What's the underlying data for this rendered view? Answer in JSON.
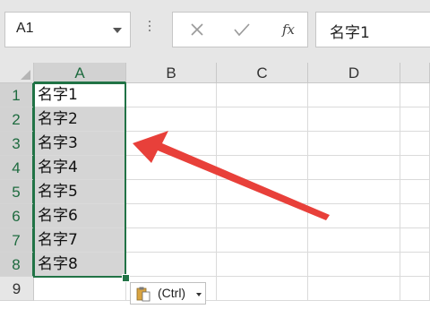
{
  "name_box": {
    "value": "A1",
    "dropdown_icon": "chevron-down-icon"
  },
  "formula_bar": {
    "cancel_icon": "close-icon",
    "enter_icon": "check-icon",
    "fx_label": "fx",
    "value": "名字1"
  },
  "columns": [
    "A",
    "B",
    "C",
    "D"
  ],
  "rows": [
    "1",
    "2",
    "3",
    "4",
    "5",
    "6",
    "7",
    "8",
    "9"
  ],
  "cells": {
    "A": [
      "名字1",
      "名字2",
      "名字3",
      "名字4",
      "名字5",
      "名字6",
      "名字7",
      "名字8",
      ""
    ]
  },
  "selected_range": "A1:A8",
  "paste_options": {
    "label": "(Ctrl)",
    "icon": "paste-clipboard-icon"
  },
  "annotation": {
    "icon": "red-arrow-icon",
    "color": "#e8403a"
  },
  "colors": {
    "selection": "#217346",
    "selected_fill": "#d5d5d5",
    "header_bg": "#e6e6e6"
  }
}
